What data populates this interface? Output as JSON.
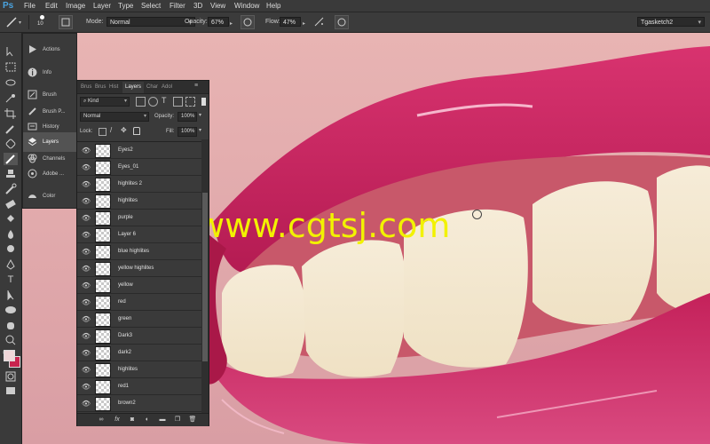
{
  "app": {
    "logo": "Ps"
  },
  "menu": [
    "File",
    "Edit",
    "Image",
    "Layer",
    "Type",
    "Select",
    "Filter",
    "3D",
    "View",
    "Window",
    "Help"
  ],
  "options": {
    "brush_size": "10",
    "mode_label": "Mode:",
    "mode_value": "Normal",
    "opacity_label": "Opacity:",
    "opacity_value": "67%",
    "flow_label": "Flow:",
    "flow_value": "47%",
    "workspace": "Tgasketch2"
  },
  "panel_strip": [
    {
      "label": "Actions",
      "icon": "play-icon"
    },
    {
      "label": "Info",
      "icon": "info-icon"
    },
    {
      "label": "Brush",
      "icon": "brush-icon"
    },
    {
      "label": "Brush P...",
      "icon": "brush-presets-icon"
    },
    {
      "label": "History",
      "icon": "history-icon"
    },
    {
      "label": "Layers",
      "icon": "layers-icon"
    },
    {
      "label": "Channels",
      "icon": "channels-icon"
    },
    {
      "label": "Adobe ...",
      "icon": "adobe-icon"
    },
    {
      "label": "Color",
      "icon": "color-icon"
    }
  ],
  "layers_panel": {
    "tabs": [
      "Brus",
      "Brus",
      "Hist",
      "Layers",
      "Char",
      "Adol"
    ],
    "filter": "Kind",
    "blend_mode": "Normal",
    "opacity_label": "Opacity:",
    "opacity_value": "100%",
    "lock_label": "Lock:",
    "fill_label": "Fill:",
    "fill_value": "100%",
    "layers": [
      "Eyes2",
      "Eyes_01",
      "highlites 2",
      "highlites",
      "purple",
      "Layer 6",
      "blue highlites",
      "yellow highlites",
      "yellow",
      "red",
      "green",
      "Dark3",
      "dark2",
      "highlites",
      "red1",
      "brown2"
    ]
  },
  "watermark": "www.cgtsj.com",
  "colors": {
    "foreground": "#f0d6d8",
    "background": "#c8244e",
    "accent": "#4aa3df"
  }
}
